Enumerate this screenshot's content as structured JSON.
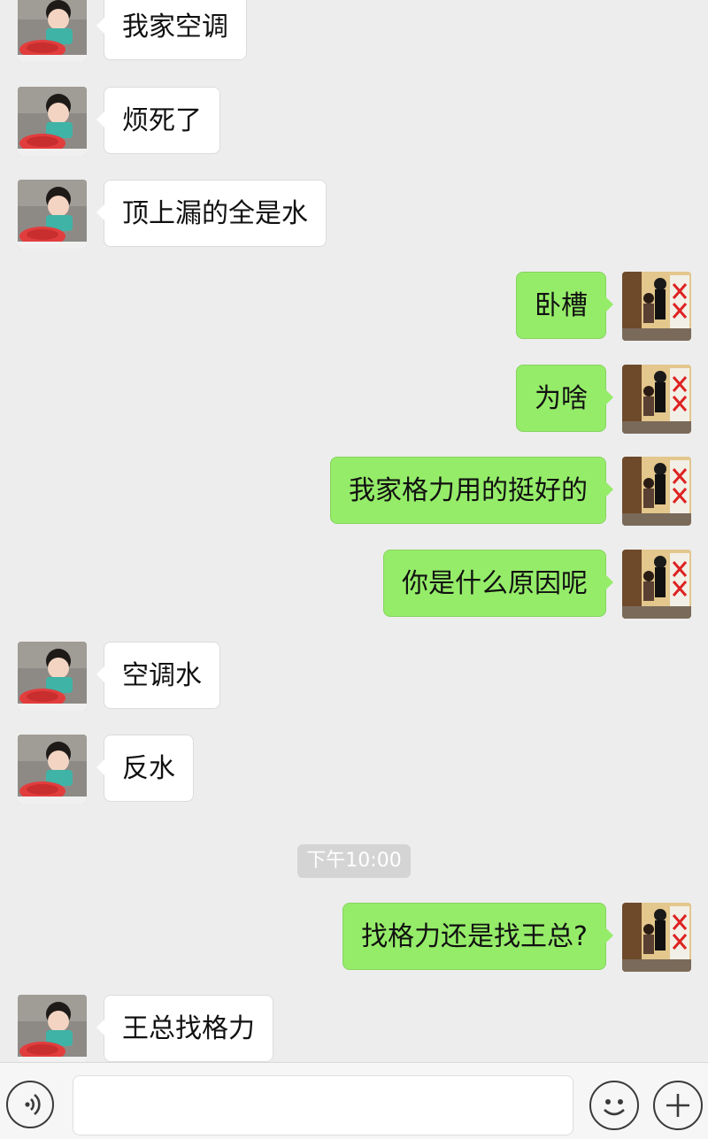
{
  "messages": [
    {
      "side": "left",
      "text": "我家空调"
    },
    {
      "side": "left",
      "text": "烦死了"
    },
    {
      "side": "left",
      "text": "顶上漏的全是水"
    },
    {
      "side": "right",
      "text": "卧槽"
    },
    {
      "side": "right",
      "text": "为啥"
    },
    {
      "side": "right",
      "text": "我家格力用的挺好的"
    },
    {
      "side": "right",
      "text": "你是什么原因呢"
    },
    {
      "side": "left",
      "text": "空调水"
    },
    {
      "side": "left",
      "text": "反水"
    },
    {
      "side": "right",
      "text": "找格力还是找王总?"
    },
    {
      "side": "left",
      "text": "王总找格力"
    }
  ],
  "timestamp": "下午10:00",
  "input_bar": {
    "voice_icon": "voice-icon",
    "emoji_icon": "emoji-icon",
    "plus_icon": "plus-icon",
    "text_value": ""
  },
  "colors": {
    "background": "#ededed",
    "sent_bubble": "#95ec69",
    "received_bubble": "#ffffff",
    "timestamp_bg": "#d4d4d4"
  }
}
